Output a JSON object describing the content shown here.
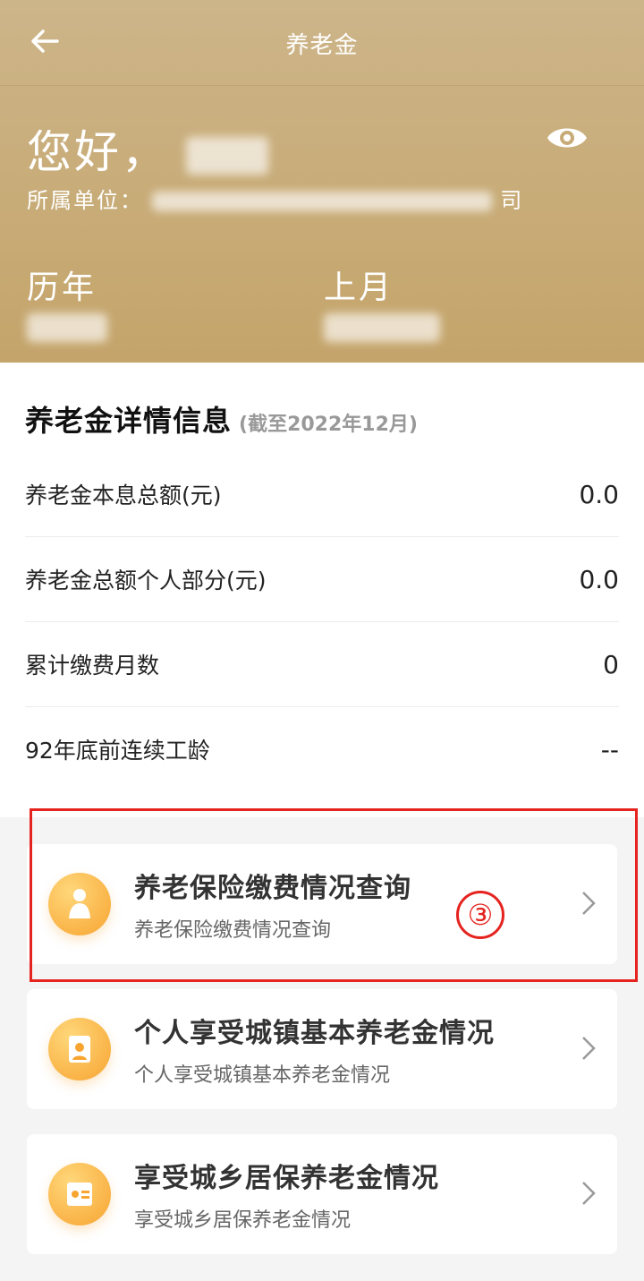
{
  "header": {
    "title": "养老金",
    "greeting": "您好，",
    "unit_label": "所属单位：",
    "unit_suffix": "司",
    "stats": [
      {
        "label": "历年"
      },
      {
        "label": "上月"
      }
    ]
  },
  "details": {
    "title": "养老金详情信息",
    "subtitle": "(截至2022年12月)",
    "rows": [
      {
        "label": "养老金本息总额(元)",
        "value": "0.0"
      },
      {
        "label": "养老金总额个人部分(元)",
        "value": "0.0"
      },
      {
        "label": "累计缴费月数",
        "value": "0"
      },
      {
        "label": "92年底前连续工龄",
        "value": "--"
      }
    ]
  },
  "cards": [
    {
      "title": "养老保险缴费情况查询",
      "subtitle": "养老保险缴费情况查询",
      "icon": "elderly-person-icon"
    },
    {
      "title": "个人享受城镇基本养老金情况",
      "subtitle": "个人享受城镇基本养老金情况",
      "icon": "pension-document-icon"
    },
    {
      "title": "享受城乡居保养老金情况",
      "subtitle": "享受城乡居保养老金情况",
      "icon": "id-card-icon"
    }
  ],
  "annotation": {
    "marker": "③",
    "color": "#e5231f"
  },
  "colors": {
    "header_gold": "#c8ac78",
    "accent_orange": "#f7a431"
  }
}
